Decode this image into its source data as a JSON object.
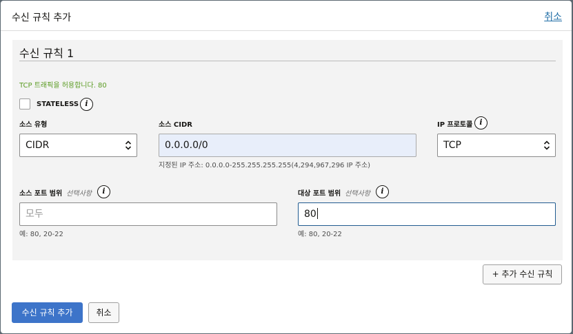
{
  "dialog": {
    "title": "수신 규칙 추가",
    "cancel_link": "취소"
  },
  "rule": {
    "title": "수신 규칙 1",
    "traffic_hint": "TCP 트래픽을 허용합니다. 80",
    "stateless_label": "STATELESS",
    "stateless_checked": false,
    "source_type": {
      "label": "소스 유형",
      "value": "CIDR"
    },
    "source_cidr": {
      "label": "소스 CIDR",
      "value": "0.0.0.0/0",
      "help": "지정된 IP 주소: 0.0.0.0-255.255.255.255(4,294,967,296 IP 주소)"
    },
    "ip_protocol": {
      "label": "IP 프로토콜",
      "value": "TCP"
    },
    "source_port": {
      "label": "소스 포트 범위",
      "optional": "선택사항",
      "placeholder": "모두",
      "value": "",
      "help": "예: 80, 20-22"
    },
    "dest_port": {
      "label": "대상 포트 범위",
      "optional": "선택사항",
      "value": "80",
      "help": "예: 80, 20-22"
    }
  },
  "buttons": {
    "add_another": "+ 추가 수신 규칙",
    "submit": "수신 규칙 추가",
    "cancel": "취소"
  },
  "colors": {
    "primary": "#3d74c9",
    "link": "#1f6da6",
    "hint_green": "#5a9b22",
    "panel_bg": "#f3f3f3",
    "readonly_bg": "#e8eefa"
  },
  "icons": [
    "info-icon",
    "chevron-up-down-icon"
  ]
}
